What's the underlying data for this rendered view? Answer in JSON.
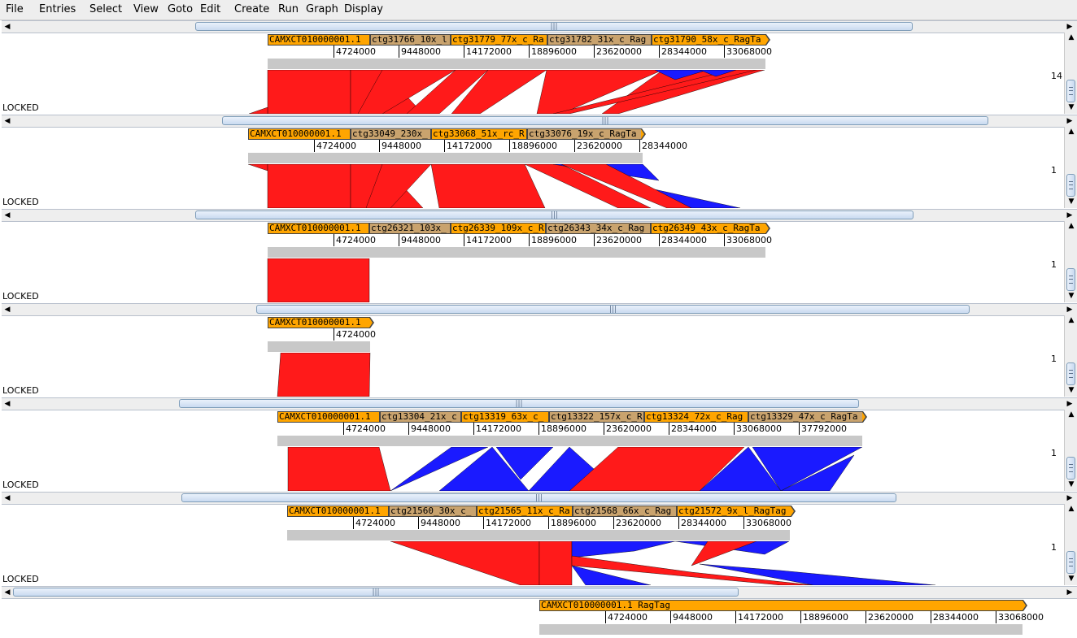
{
  "menu": {
    "items": [
      {
        "label": "File",
        "accel": "F"
      },
      {
        "label": "Entries",
        "accel": "E"
      },
      {
        "label": "Select",
        "accel": "S"
      },
      {
        "label": "View",
        "accel": "V"
      },
      {
        "label": "Goto",
        "accel": "G"
      },
      {
        "label": "Edit",
        "accel": "E"
      },
      {
        "label": "Create",
        "accel": "C"
      },
      {
        "label": "Run",
        "accel": "R"
      },
      {
        "label": "Graph",
        "accel": "G"
      },
      {
        "label": "Display",
        "accel": "D"
      }
    ]
  },
  "locked_label": "LOCKED",
  "colors": {
    "forward_match": "#ff1a1a",
    "reverse_match": "#1a1aff",
    "contig": "#ffa500",
    "contig_alt": "#c9a36e",
    "sequence_bar": "#c8c8c8"
  },
  "icons": {
    "left": "scroll-left-arrow-icon",
    "right": "scroll-right-arrow-icon",
    "up": "scroll-up-arrow-icon",
    "down": "scroll-down-arrow-icon"
  },
  "scroll_glyphs": {
    "left": "◀",
    "right": "▶",
    "up": "▲",
    "down": "▼",
    "grip": "|||"
  },
  "scale_labels": [
    "14",
    "1",
    "1",
    "1",
    "1",
    "1"
  ],
  "tracks": [
    {
      "features": [
        "CAMXCT010000001.1",
        "ctg31766_10x_l",
        "ctg31779_77x_c_Ra",
        "ctg31782_31x_c_Rag",
        "ctg31790_58x_c_RagTa"
      ],
      "ticks": [
        "4724000",
        "9448000",
        "14172000",
        "18896000",
        "23620000",
        "28344000",
        "33068000"
      ]
    },
    {
      "features": [
        "CAMXCT010000001.1",
        "ctg33049_230x_",
        "ctg33068_51x_rc_R",
        "ctg33076_19x_c_RagTa"
      ],
      "ticks": [
        "4724000",
        "9448000",
        "14172000",
        "18896000",
        "23620000",
        "28344000"
      ]
    },
    {
      "features": [
        "CAMXCT010000001.1",
        "ctg26321_103x_",
        "ctg26339_109x_c_R",
        "ctg26343_34x_c_Rag",
        "ctg26349_43x_c_RagTa"
      ],
      "ticks": [
        "4724000",
        "9448000",
        "14172000",
        "18896000",
        "23620000",
        "28344000",
        "33068000"
      ]
    },
    {
      "features": [
        "CAMXCT010000001.1"
      ],
      "ticks": [
        "4724000"
      ]
    },
    {
      "features": [
        "CAMXCT010000001.1",
        "ctg13304_21x_c",
        "ctg13319_63x_c_",
        "ctg13322_157x_c_R",
        "ctg13324_72x_c_Rag",
        "ctg13329_47x_c_RagTa"
      ],
      "ticks": [
        "4724000",
        "9448000",
        "14172000",
        "18896000",
        "23620000",
        "28344000",
        "33068000",
        "37792000"
      ]
    },
    {
      "features": [
        "CAMXCT010000001.1",
        "ctg21560_30x_c_",
        "ctg21565_11x_c_Ra",
        "ctg21568_66x_c_Rag",
        "ctg21572_9x_l_RagTag"
      ],
      "ticks": [
        "4724000",
        "9448000",
        "14172000",
        "18896000",
        "23620000",
        "28344000",
        "33068000"
      ]
    },
    {
      "features": [
        "CAMXCT010000001.1 RagTag"
      ],
      "ticks": [
        "4724000",
        "9448000",
        "14172000",
        "18896000",
        "23620000",
        "28344000",
        "33068000"
      ]
    }
  ]
}
